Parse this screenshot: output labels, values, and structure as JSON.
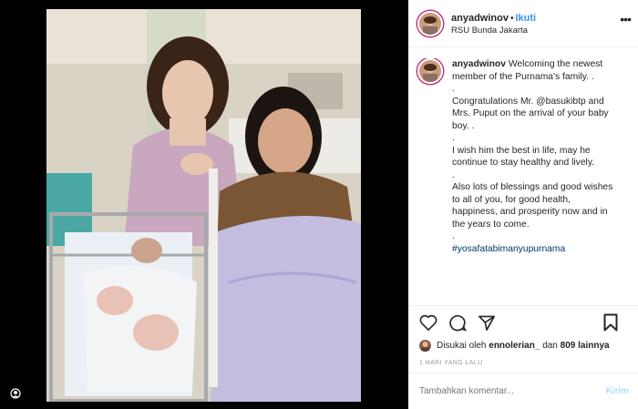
{
  "post": {
    "username": "anyadwinov",
    "separator": "•",
    "follow_label": "Ikuti",
    "location": "RSU Bunda Jakarta",
    "more_icon": "more-icon"
  },
  "caption": {
    "username": "anyadwinov",
    "lines": [
      "Welcoming the newest member of the Purnama's family. .",
      ".",
      "Congratulations Mr. @basukibtp and Mrs. Puput on the arrival of your baby boy. .",
      ".",
      "I wish him the best in life, may he continue to stay healthy and lively.",
      ".",
      "Also lots of blessings and good wishes to all of you, for good health, happiness, and prosperity now and in the years to come.",
      ".",
      "#yosafatabimanyupurnama"
    ]
  },
  "actions": {
    "like_icon": "heart-icon",
    "comment_icon": "comment-icon",
    "share_icon": "share-icon",
    "save_icon": "bookmark-icon"
  },
  "likes": {
    "prefix": "Disukai oleh",
    "user": "ennolerian_",
    "joiner": "dan",
    "count": "809 lainnya"
  },
  "timestamp": "1 HARI YANG LALU",
  "comment_box": {
    "placeholder": "Tambahkan komentar...",
    "send_label": "Kirim"
  },
  "colors": {
    "link": "#3897f0",
    "hashtag": "#003569",
    "send_disabled": "#b2dffc"
  }
}
